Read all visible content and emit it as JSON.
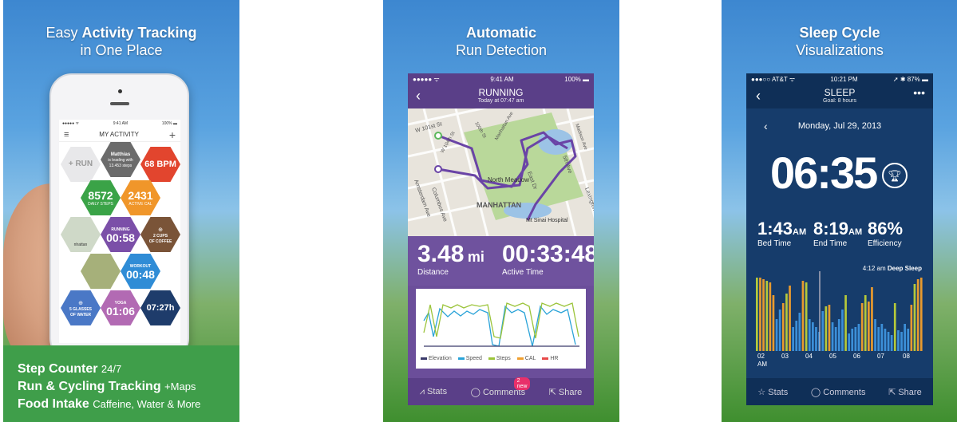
{
  "panel1": {
    "hero_pre": "Easy ",
    "hero_bold": "Activity Tracking",
    "hero_line2": "in One Place",
    "status_left": "●●●●● ᯤ",
    "status_time": "9:41 AM",
    "status_right": "100% ▬",
    "screen_title": "MY ACTIVITY",
    "tiles": {
      "run": "+ RUN",
      "matthias": "Matthias",
      "matthias_sub": "is leading with",
      "matthias_steps": "13.453 steps",
      "bpm": "68 BPM",
      "steps": "8572",
      "steps_label": "DAILY STEPS",
      "cal": "2431",
      "cal_label": "ACTIVE CAL",
      "running_label": "RUNNING",
      "running_val": "00:58",
      "coffee": "2 CUPS",
      "coffee2": "OF COFFEE",
      "map_label": "nhattan",
      "workout_label": "WORKOUT",
      "workout_val": "00:48",
      "water": "5 GLASSES",
      "water2": "OF WATER",
      "yoga_label": "YOGA",
      "yoga_val": "01:06",
      "sleep_val": "07:27h"
    },
    "features": [
      {
        "main": "Step Counter",
        "extra": "24/7"
      },
      {
        "main": "Run & Cycling Tracking",
        "extra": "+Maps"
      },
      {
        "main": "Food Intake",
        "extra": "Caffeine, Water & More"
      }
    ]
  },
  "panel2": {
    "hero_line1": "Automatic",
    "hero_line2": "Run Detection",
    "status_left": "●●●●● ᯤ",
    "status_time": "9:41 AM",
    "status_right": "100% ▬",
    "title": "RUNNING",
    "subtitle": "Today at 07:47 am",
    "map_labels": [
      "W 101st St",
      "Amsterdam Ave",
      "Columbus Ave",
      "North Meadow",
      "MANHATTAN",
      "Mt Sinai Hospital",
      "East Dr",
      "5th Ave",
      "Lexington Ave",
      "W 104th St",
      "Manhattan Ave",
      "100th St",
      "Madison Ave"
    ],
    "distance_value": "3.48",
    "distance_unit": "mi",
    "distance_label": "Distance",
    "time_value": "00:33:48",
    "time_label": "Active Time",
    "legend": [
      "Elevation",
      "Speed",
      "Steps",
      "CAL",
      "HR"
    ],
    "legend_colors": [
      "#3b3b6b",
      "#2aa3d8",
      "#9bc43a",
      "#f0a030",
      "#e84a4a"
    ],
    "tab_stats": "Stats",
    "tab_comments": "Comments",
    "tab_comments_badge": "2 new",
    "tab_share": "Share"
  },
  "panel3": {
    "hero_line1": "Sleep Cycle",
    "hero_line2": "Visualizations",
    "status_left": "●●●○○ AT&T ᯤ",
    "status_time": "10:21 PM",
    "status_right": "➚ ✱ 87% ▬",
    "title": "SLEEP",
    "subtitle": "Goal: 8 hours",
    "date": "Monday, Jul 29, 2013",
    "big_time": "06:35",
    "bed_val": "1:43",
    "bed_unit": "AM",
    "bed_label": "Bed Time",
    "end_val": "8:19",
    "end_unit": "AM",
    "end_label": "End Time",
    "eff_val": "86%",
    "eff_label": "Efficiency",
    "marker_time": "4:12 am",
    "marker_label": "Deep Sleep",
    "hours": [
      "02",
      "03",
      "04",
      "05",
      "06",
      "07",
      "08"
    ],
    "first_hour_suffix": "AM",
    "tab_stats": "Stats",
    "tab_comments": "Comments",
    "tab_share": "Share"
  }
}
